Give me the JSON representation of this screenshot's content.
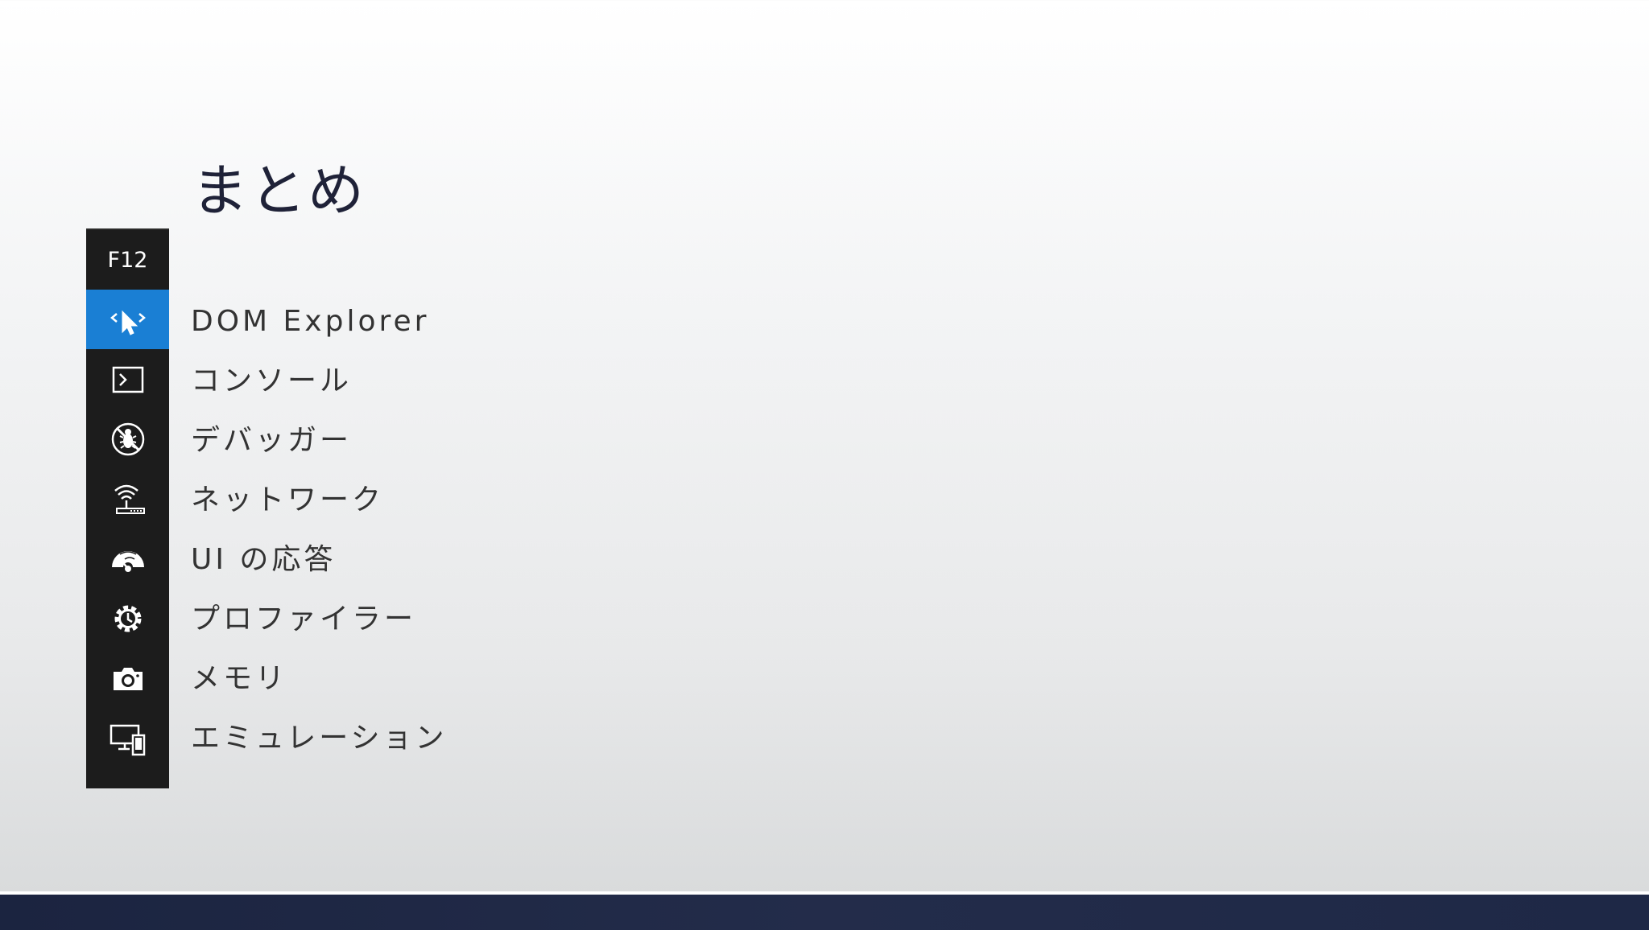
{
  "slide": {
    "title": "まとめ"
  },
  "toolbar": {
    "header": "F12",
    "active_color": "#1a7fd4",
    "items": [
      {
        "icon": "dom-explorer-icon",
        "label": "DOM Explorer",
        "active": true
      },
      {
        "icon": "console-icon",
        "label": "コンソール",
        "active": false
      },
      {
        "icon": "debugger-icon",
        "label": "デバッガー",
        "active": false
      },
      {
        "icon": "network-icon",
        "label": "ネットワーク",
        "active": false
      },
      {
        "icon": "ui-responsiveness-icon",
        "label": "UI の応答",
        "active": false
      },
      {
        "icon": "profiler-icon",
        "label": "プロファイラー",
        "active": false
      },
      {
        "icon": "memory-icon",
        "label": "メモリ",
        "active": false
      },
      {
        "icon": "emulation-icon",
        "label": "エミュレーション",
        "active": false
      }
    ]
  }
}
